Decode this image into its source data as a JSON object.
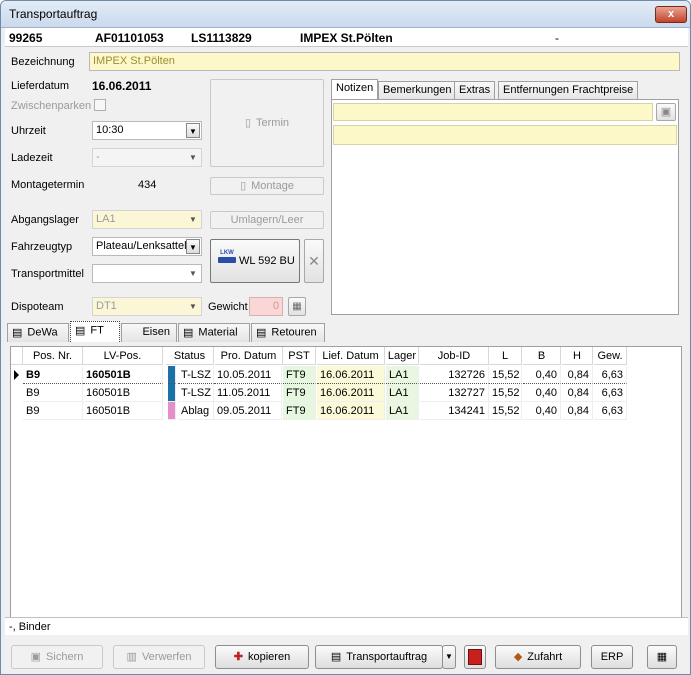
{
  "window": {
    "title": "Transportauftrag",
    "close_glyph": "x"
  },
  "header": {
    "nr": "99265",
    "auftrag": "AF01101053",
    "ls": "LS1113829",
    "kunde": "IMPEX St.Pölten",
    "dash": "-"
  },
  "form": {
    "bezeichnung_label": "Bezeichnung",
    "bezeichnung_value": "IMPEX St.Pölten",
    "lieferdatum_label": "Lieferdatum",
    "lieferdatum_value": "16.06.2011",
    "zwischenparken_label": "Zwischenparken",
    "uhrzeit_label": "Uhrzeit",
    "uhrzeit_value": "10:30",
    "ladezeit_label": "Ladezeit",
    "ladezeit_value": "-",
    "montagetermin_label": "Montagetermin",
    "montagetermin_value": "434",
    "abgangslager_label": "Abgangslager",
    "abgangslager_value": "LA1",
    "fahrzeugtyp_label": "Fahrzeugtyp",
    "fahrzeugtyp_value": "Plateau/Lenksattel",
    "transportmittel_label": "Transportmittel",
    "transportmittel_value": "",
    "dispoteam_label": "Dispoteam",
    "dispoteam_value": "DT1",
    "gewicht_label": "Gewicht",
    "gewicht_value": "0"
  },
  "buttons": {
    "termin": "Termin",
    "montage": "Montage",
    "umlagern": "Umlagern/Leer",
    "lkw_small": "LKW",
    "lkw": "WL 592 BU"
  },
  "notes_tabs": [
    "Notizen",
    "Bemerkungen",
    "Extras",
    "Entfernungen Frachtpreise"
  ],
  "main_tabs": [
    "DeWa",
    "FT",
    "Eisen",
    "Material",
    "Retouren"
  ],
  "grid": {
    "columns": [
      "Pos. Nr.",
      "LV-Pos.",
      "Status",
      "Pro. Datum",
      "PST",
      "Lief. Datum",
      "Lager",
      "Job-ID",
      "L",
      "B",
      "H",
      "Gew."
    ],
    "rows": [
      {
        "pos": "B9",
        "lv": "160501B",
        "color": "#1a73a8",
        "status": "T-LSZ",
        "pro": "10.05.2011",
        "pst": "FT9",
        "lief": "16.06.2011",
        "lager": "LA1",
        "job": "132726",
        "l": "15,52",
        "b": "0,40",
        "h": "0,84",
        "gew": "6,63"
      },
      {
        "pos": "B9",
        "lv": "160501B",
        "color": "#1a73a8",
        "status": "T-LSZ",
        "pro": "11.05.2011",
        "pst": "FT9",
        "lief": "16.06.2011",
        "lager": "LA1",
        "job": "132727",
        "l": "15,52",
        "b": "0,40",
        "h": "0,84",
        "gew": "6,63"
      },
      {
        "pos": "B9",
        "lv": "160501B",
        "color": "#e58fc9",
        "status": "Ablag",
        "pro": "09.05.2011",
        "pst": "FT9",
        "lief": "16.06.2011",
        "lager": "LA1",
        "job": "134241",
        "l": "15,52",
        "b": "0,40",
        "h": "0,84",
        "gew": "6,63"
      }
    ]
  },
  "status_bar": "-, Binder",
  "bottom": {
    "sichern": "Sichern",
    "verwerfen": "Verwerfen",
    "kopieren": "kopieren",
    "transportauftrag": "Transportauftrag",
    "zufahrt": "Zufahrt",
    "erp": "ERP"
  }
}
